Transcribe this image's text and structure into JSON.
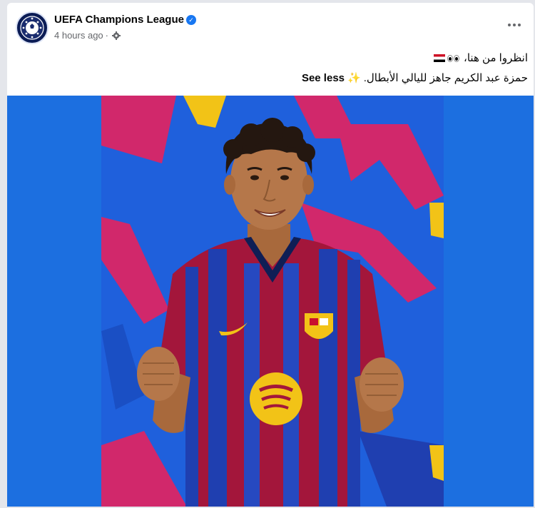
{
  "post": {
    "page_name": "UEFA Champions League",
    "timestamp": "4 hours ago",
    "separator": "·",
    "audience_icon": "gear-icon",
    "more_icon": "more-options-icon",
    "caption_line1": "انظروا من هنا،",
    "caption_line2": "حمزة عبد الكريم جاهز لليالي الأبطال.",
    "see_less": "See less"
  },
  "colors": {
    "photo_background": "#1f60dc",
    "accent_pink": "#d1286b",
    "accent_yellow": "#f2c317",
    "verified_blue": "#1877f2"
  }
}
